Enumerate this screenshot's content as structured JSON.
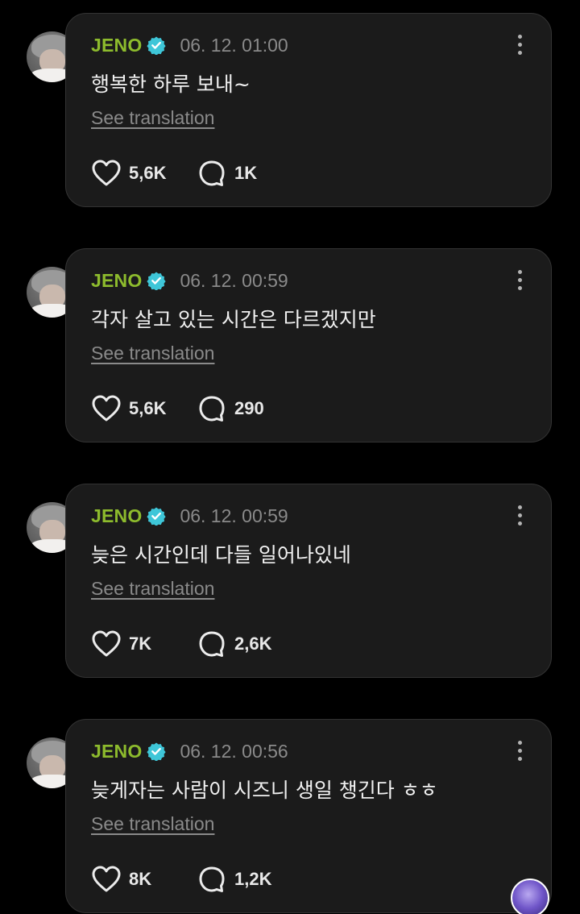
{
  "colors": {
    "background": "#000000",
    "card": "#1b1b1b",
    "username": "#8dbb2d",
    "verified": "#3ec6d8",
    "muted": "#8a8a8a"
  },
  "posts": [
    {
      "username": "JENO",
      "timestamp": "06. 12. 01:00",
      "text": "행복한 하루 보내~",
      "translate_label": "See translation",
      "likes": "5,6K",
      "comments": "1K"
    },
    {
      "username": "JENO",
      "timestamp": "06. 12. 00:59",
      "text": "각자 살고 있는 시간은 다르겠지만",
      "translate_label": "See translation",
      "likes": "5,6K",
      "comments": "290"
    },
    {
      "username": "JENO",
      "timestamp": "06. 12. 00:59",
      "text": "늦은 시간인데 다들 일어나있네",
      "translate_label": "See translation",
      "likes": "7K",
      "comments": "2,6K"
    },
    {
      "username": "JENO",
      "timestamp": "06. 12. 00:56",
      "text": "늦게자는 사람이 시즈니 생일 챙긴다 ㅎㅎ",
      "translate_label": "See translation",
      "likes": "8K",
      "comments": "1,2K"
    }
  ],
  "icons": {
    "verified": "verified-badge-icon",
    "more": "more-vertical-icon",
    "like": "heart-outline-icon",
    "comment": "speech-bubble-icon"
  }
}
